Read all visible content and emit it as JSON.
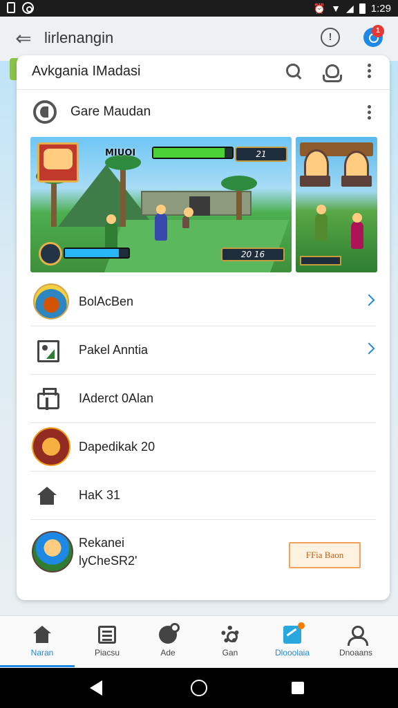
{
  "status_bar": {
    "time": "1:29",
    "icons": [
      "notification-box-icon",
      "sync-icon",
      "alarm-icon",
      "wifi-icon",
      "signal-icon",
      "battery-icon"
    ]
  },
  "app_bar": {
    "title": "lirlenangin",
    "icons": [
      "back-arrow-icon",
      "info-icon",
      "account-icon"
    ],
    "badge": "1"
  },
  "card": {
    "title": "Avkgania IMadasi",
    "header_icons": [
      "search-icon",
      "share-icon",
      "more-vert-icon"
    ],
    "subheader": {
      "title": "Gare Maudan",
      "icon": "game-controller-icon"
    },
    "screenshot_main": {
      "player_name": "MIUOI",
      "score_top": "21",
      "score_bottom": "20 16",
      "health": 0.9,
      "energy": 0.85
    }
  },
  "list": [
    {
      "label": "BolAcBen",
      "icon": "game-thumbnail",
      "chevron": true
    },
    {
      "label": "Pakel Anntia",
      "icon": "photo-icon",
      "chevron": true
    },
    {
      "label": "IAderct 0Alan",
      "icon": "building-icon",
      "chevron": false
    },
    {
      "label": "Dapedikak 20",
      "icon": "game-badge-thumbnail",
      "chevron": false
    },
    {
      "label": "HaK 31",
      "icon": "home-icon",
      "chevron": false
    },
    {
      "label_line1": "Rekanei",
      "label_line2": "lyCheSR2'",
      "icon": "player-avatar",
      "button_label": "FFia Baon"
    }
  ],
  "bottom_nav": [
    {
      "label": "Naran",
      "icon": "home-icon",
      "active": true
    },
    {
      "label": "Piacsu",
      "icon": "document-icon",
      "active": false
    },
    {
      "label": "Ade",
      "icon": "chat-icon",
      "active": false
    },
    {
      "label": "Gan",
      "icon": "settings-icon",
      "active": false
    },
    {
      "label": "Dlooolaia",
      "icon": "map-icon",
      "active": false,
      "highlight": true
    },
    {
      "label": "Dnoaans",
      "icon": "person-icon",
      "active": false
    }
  ],
  "colors": {
    "accent": "#1e88e5",
    "cta_border": "#f0a15a",
    "cta_text": "#c25e12",
    "badge": "#e53935"
  }
}
